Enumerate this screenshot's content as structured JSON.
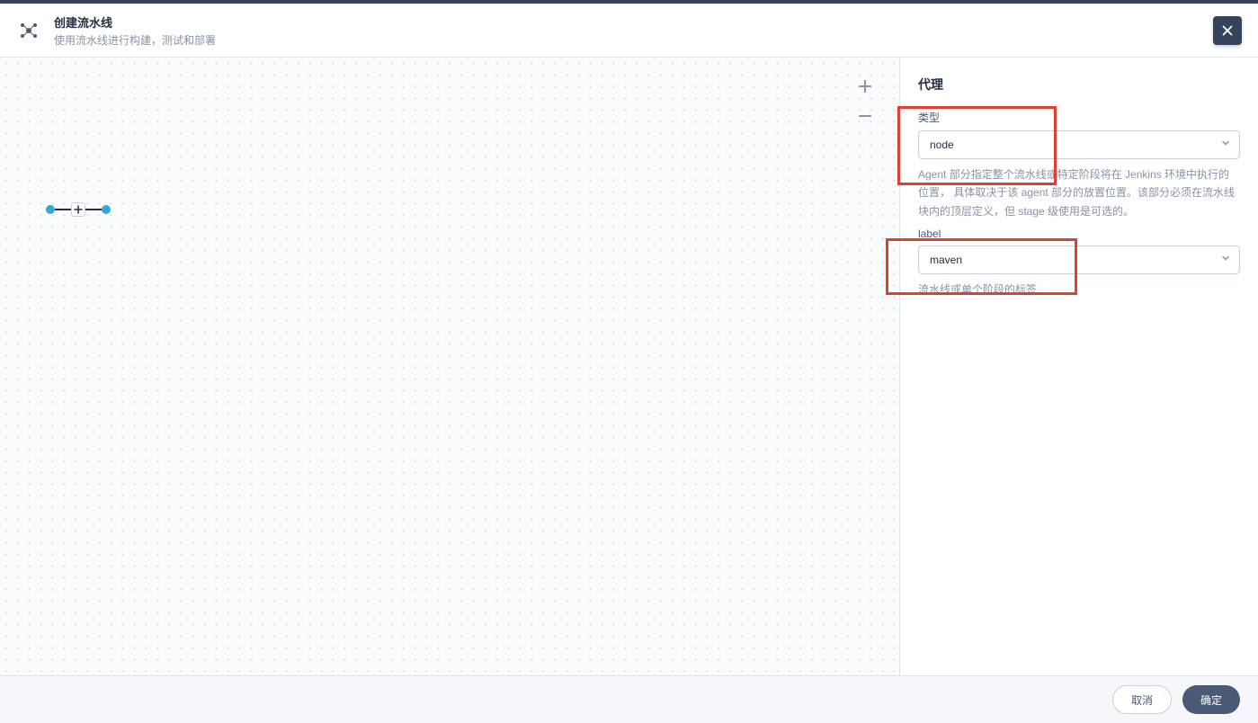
{
  "header": {
    "title": "创建流水线",
    "subtitle": "使用流水线进行构建，测试和部署"
  },
  "panel": {
    "title": "代理",
    "type_label": "类型",
    "type_value": "node",
    "type_help": "Agent 部分指定整个流水线或特定阶段将在 Jenkins 环境中执行的位置， 具体取决于该 agent 部分的放置位置。该部分必须在流水线块内的顶层定义，但 stage 级使用是可选的。",
    "label_label": "label",
    "label_value": "maven",
    "label_help": "流水线或单个阶段的标签"
  },
  "footer": {
    "cancel": "取消",
    "confirm": "确定"
  }
}
